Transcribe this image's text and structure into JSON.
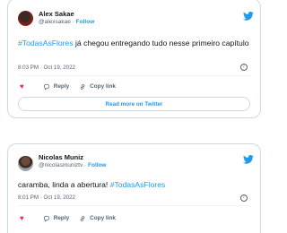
{
  "colors": {
    "accent": "#1d9bf0",
    "like": "#f91880",
    "muted": "#536471",
    "border": "#cfd9de"
  },
  "tweets": [
    {
      "author_name": "Alex Sakae",
      "handle": "@alexsakae",
      "follow_label": "Follow",
      "text_hashtag": "#TodasAsFlores",
      "text_body": " já chegou entregando tudo nesse primeiro capítulo",
      "timestamp": "8:03 PM · Oct 19, 2022",
      "reply_label": "Reply",
      "copy_link_label": "Copy link",
      "read_more_label": "Read more on Twitter",
      "icons": [
        "twitter-bird-icon",
        "info-icon",
        "heart-icon",
        "reply-icon",
        "link-icon"
      ]
    },
    {
      "author_name": "Nicolas Muniz",
      "handle": "@nicolasmuniztv",
      "follow_label": "Follow",
      "text_body": "caramba, linda a abertura! ",
      "text_hashtag": "#TodasAsFlores",
      "timestamp": "8:01 PM · Oct 19, 2022",
      "reply_label": "Reply",
      "copy_link_label": "Copy link",
      "icons": [
        "twitter-bird-icon",
        "info-icon",
        "heart-icon",
        "reply-icon",
        "link-icon"
      ]
    }
  ]
}
